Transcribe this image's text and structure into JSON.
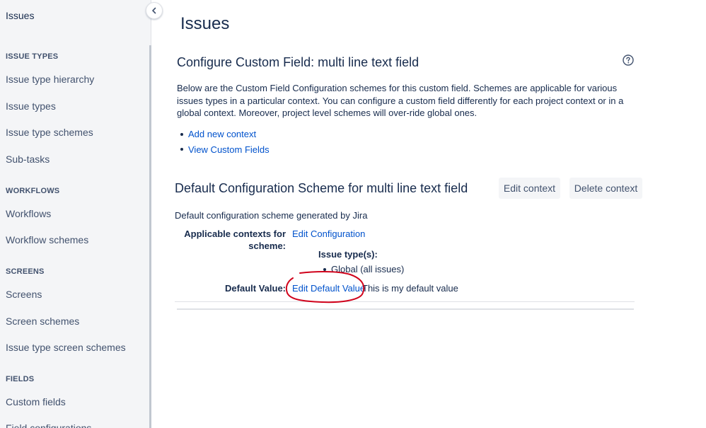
{
  "sidebar": {
    "title": "Issues",
    "sections": [
      {
        "heading": "ISSUE TYPES",
        "items": [
          "Issue type hierarchy",
          "Issue types",
          "Issue type schemes",
          "Sub-tasks"
        ]
      },
      {
        "heading": "WORKFLOWS",
        "items": [
          "Workflows",
          "Workflow schemes"
        ]
      },
      {
        "heading": "SCREENS",
        "items": [
          "Screens",
          "Screen schemes",
          "Issue type screen schemes"
        ]
      },
      {
        "heading": "FIELDS",
        "items": [
          "Custom fields",
          "Field configurations"
        ]
      }
    ],
    "collapse_icon": "chevron-left-icon"
  },
  "main": {
    "page_title": "Issues",
    "config_title": "Configure Custom Field: multi line text field",
    "help_icon": "question-circle-icon",
    "description": "Below are the Custom Field Configuration schemes for this custom field. Schemes are applicable for various issues types in a particular context. You can configure a custom field differently for each project context or in a global context. Moreover, project level schemes will over-ride global ones.",
    "links": [
      "Add new context",
      "View Custom Fields"
    ]
  },
  "scheme": {
    "title": "Default Configuration Scheme for multi line text field",
    "edit_context": "Edit context",
    "delete_context": "Delete context",
    "description": "Default configuration scheme generated by Jira",
    "contexts_label_line1": "Applicable contexts for",
    "contexts_label_line2": "scheme:",
    "edit_configuration": "Edit Configuration",
    "issue_types_label": "Issue type(s):",
    "issue_type_value": "Global (all issues)",
    "default_value_label": "Default Value:",
    "edit_default_value": "Edit Default Value",
    "default_value": "This is my default value"
  },
  "colors": {
    "link": "#0052cc",
    "text": "#172b4d",
    "annotation": "#d0021b"
  }
}
